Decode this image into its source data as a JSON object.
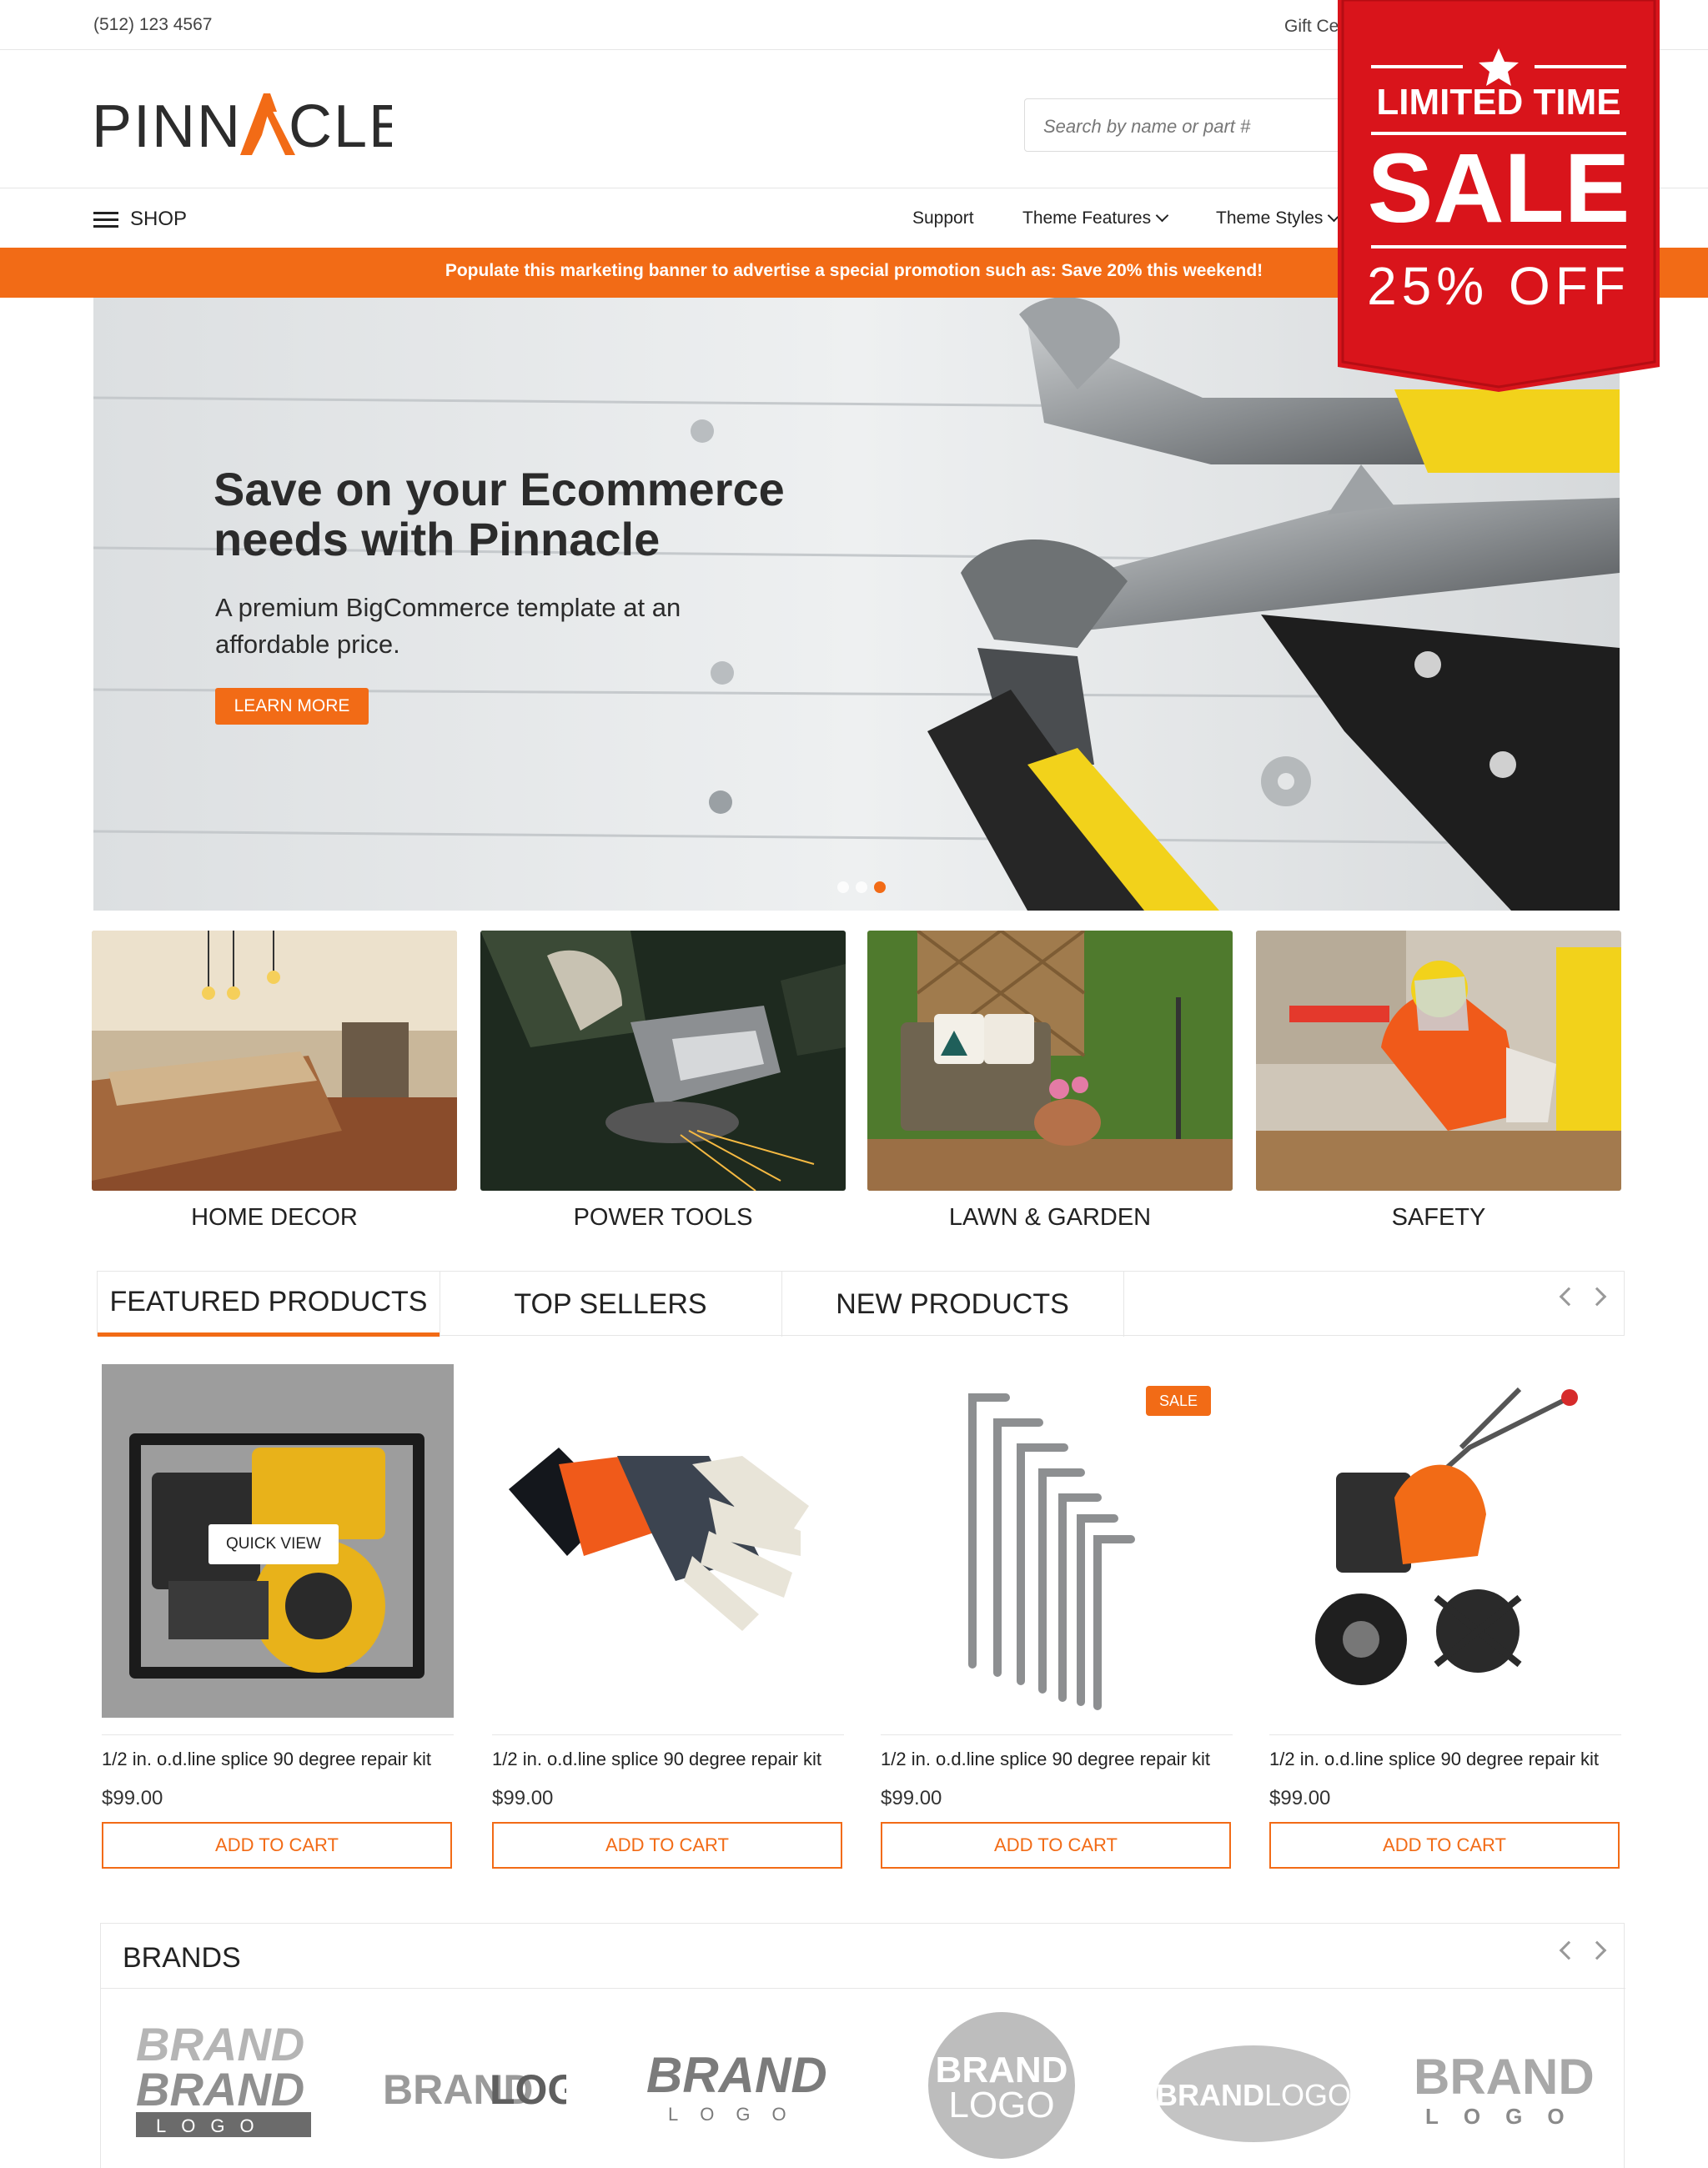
{
  "topbar": {
    "phone": "(512) 123 4567",
    "gift": "Gift Ce"
  },
  "header": {
    "logo_text": "PINNACLE",
    "search_placeholder": "Search by name or part #"
  },
  "nav": {
    "shop_label": "SHOP",
    "links": [
      {
        "label": "Support",
        "has_dropdown": false
      },
      {
        "label": "Theme Features",
        "has_dropdown": true
      },
      {
        "label": "Theme Styles",
        "has_dropdown": true
      }
    ]
  },
  "promo_banner": "Populate this marketing banner to advertise a special promotion such as: Save 20% this weekend!",
  "hero": {
    "title": "Save on your Ecommerce needs with Pinnacle",
    "subtitle": "A premium BigCommerce template at an affordable price.",
    "button": "LEARN MORE",
    "slides": 3,
    "active_slide": 3
  },
  "categories": [
    "HOME DECOR",
    "POWER TOOLS",
    "LAWN & GARDEN",
    "SAFETY"
  ],
  "tabs": [
    "FEATURED PRODUCTS",
    "TOP SELLERS",
    "NEW PRODUCTS"
  ],
  "products": [
    {
      "name": "1/2 in. o.d.line splice 90 degree repair kit",
      "price": "$99.00",
      "button": "ADD TO CART",
      "quick_view": "QUICK VIEW"
    },
    {
      "name": "1/2 in. o.d.line splice 90 degree repair kit",
      "price": "$99.00",
      "button": "ADD TO CART"
    },
    {
      "name": "1/2 in. o.d.line splice 90 degree repair kit",
      "price": "$99.00",
      "button": "ADD TO CART",
      "badge": "SALE"
    },
    {
      "name": "1/2 in. o.d.line splice 90 degree repair kit",
      "price": "$99.00",
      "button": "ADD TO CART"
    }
  ],
  "brands": {
    "title": "BRANDS",
    "logos": [
      "BRAND BRAND LOGO",
      "BRANDLOGO",
      "BRAND LOGO",
      "BRAND LOGO",
      "BRANDLOGO",
      "BRAND LOGO"
    ]
  },
  "sale_ribbon": {
    "line1": "LIMITED TIME",
    "line2": "SALE",
    "line3": "25% OFF"
  },
  "colors": {
    "accent": "#f26b16",
    "ribbon": "#d9141b"
  }
}
